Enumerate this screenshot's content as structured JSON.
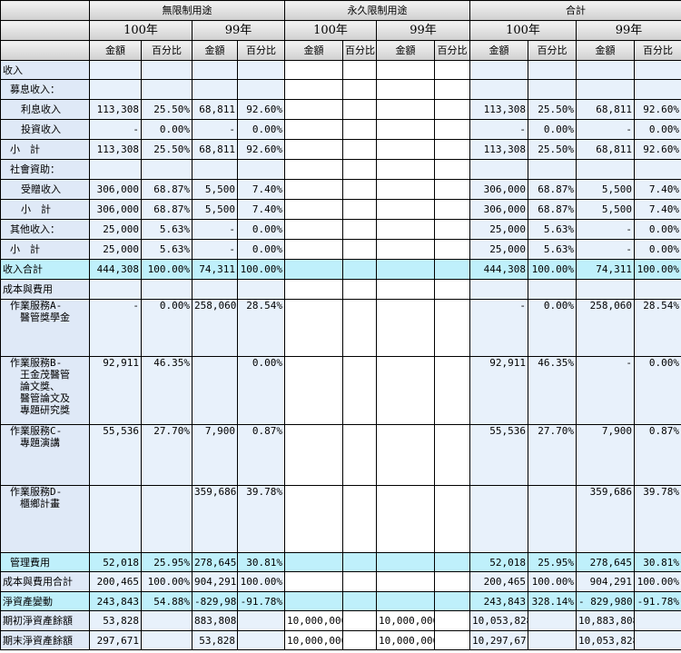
{
  "header": {
    "groups": [
      "無限制用途",
      "永久限制用途",
      "合計"
    ],
    "years": [
      "100年",
      "99年",
      "100年",
      "99年",
      "100年",
      "99年"
    ],
    "amount_label": "金額",
    "percent_label": "百分比"
  },
  "rows": [
    {
      "label": "收入",
      "indent": 0,
      "style": "plain",
      "h": 21,
      "cells": [
        "",
        "",
        "",
        "",
        "",
        "",
        "",
        "",
        "",
        "",
        "",
        ""
      ]
    },
    {
      "label": "募息收入：",
      "indent": 1,
      "style": "plain",
      "h": 22,
      "cells": [
        "",
        "",
        "",
        "",
        "",
        "",
        "",
        "",
        "",
        "",
        "",
        ""
      ]
    },
    {
      "label": "利息收入",
      "indent": 2,
      "style": "plain",
      "h": 22,
      "cells": [
        "113,308",
        "25.50%",
        "68,811",
        "92.60%",
        "",
        "",
        "",
        "",
        "113,308",
        "25.50%",
        "68,811",
        "92.60%"
      ]
    },
    {
      "label": "投資收入",
      "indent": 2,
      "style": "plain",
      "h": 22,
      "cells": [
        "-",
        "0.00%",
        "-",
        "0.00%",
        "",
        "",
        "",
        "",
        "-",
        "0.00%",
        "-",
        "0.00%"
      ]
    },
    {
      "label": "小　計",
      "indent": 1,
      "style": "plain",
      "h": 22,
      "cells": [
        "113,308",
        "25.50%",
        "68,811",
        "92.60%",
        "",
        "",
        "",
        "",
        "113,308",
        "25.50%",
        "68,811",
        "92.60%"
      ]
    },
    {
      "label": "社會資助：",
      "indent": 1,
      "style": "plain",
      "h": 22,
      "cells": [
        "",
        "",
        "",
        "",
        "",
        "",
        "",
        "",
        "",
        "",
        "",
        ""
      ]
    },
    {
      "label": "受贈收入",
      "indent": 2,
      "style": "plain",
      "h": 22,
      "cells": [
        "306,000",
        "68.87%",
        "5,500",
        "7.40%",
        "",
        "",
        "",
        "",
        "306,000",
        "68.87%",
        "5,500",
        "7.40%"
      ]
    },
    {
      "label": "小　計",
      "indent": 2,
      "style": "plain",
      "h": 22,
      "cells": [
        "306,000",
        "68.87%",
        "5,500",
        "7.40%",
        "",
        "",
        "",
        "",
        "306,000",
        "68.87%",
        "5,500",
        "7.40%"
      ]
    },
    {
      "label": "其他收入：",
      "indent": 1,
      "style": "plain",
      "h": 22,
      "cells": [
        "25,000",
        "5.63%",
        "-",
        "0.00%",
        "",
        "",
        "",
        "",
        "25,000",
        "5.63%",
        "-",
        "0.00%"
      ]
    },
    {
      "label": "小　計",
      "indent": 1,
      "style": "plain",
      "h": 22,
      "cells": [
        "25,000",
        "5.63%",
        "-",
        "0.00%",
        "",
        "",
        "",
        "",
        "25,000",
        "5.63%",
        "-",
        "0.00%"
      ]
    },
    {
      "label": "收入合計",
      "indent": 0,
      "style": "total",
      "h": 22,
      "cells": [
        "444,308",
        "100.00%",
        "74,311",
        "100.00%",
        "",
        "",
        "",
        "",
        "444,308",
        "100.00%",
        "74,311",
        "100.00%"
      ]
    },
    {
      "label": "成本與費用",
      "indent": 0,
      "style": "plain",
      "h": 22,
      "cells": [
        "",
        "",
        "",
        "",
        "",
        "",
        "",
        "",
        "",
        "",
        "",
        ""
      ]
    },
    {
      "label": "作業服務A-\n　醫管獎學金",
      "indent": 1,
      "style": "plain",
      "h": 63,
      "top": true,
      "cells": [
        "-",
        "0.00%",
        "258,060",
        "28.54%",
        "",
        "",
        "",
        "",
        "-",
        "0.00%",
        "258,060",
        "28.54%"
      ]
    },
    {
      "label": "作業服務B-\n　王金茂醫管\n　論文獎、\n　醫管論文及\n　專題研究獎",
      "indent": 1,
      "style": "plain",
      "h": 75,
      "top": true,
      "cells": [
        "92,911",
        "46.35%",
        "",
        "0.00%",
        "",
        "",
        "",
        "",
        "92,911",
        "46.35%",
        "-",
        "0.00%"
      ]
    },
    {
      "label": "作業服務C-\n　專題演講",
      "indent": 1,
      "style": "plain",
      "h": 67,
      "top": true,
      "cells": [
        "55,536",
        "27.70%",
        "7,900",
        "0.87%",
        "",
        "",
        "",
        "",
        "55,536",
        "27.70%",
        "7,900",
        "0.87%"
      ]
    },
    {
      "label": "作業服務D-\n　櫃鄉計畫",
      "indent": 1,
      "style": "plain",
      "h": 74,
      "top": true,
      "cells": [
        "",
        "",
        "359,686",
        "39.78%",
        "",
        "",
        "",
        "",
        "",
        "",
        "359,686",
        "39.78%"
      ]
    },
    {
      "label": "管理費用",
      "indent": 1,
      "style": "total",
      "h": 21,
      "cells": [
        "52,018",
        "25.95%",
        "278,645",
        "30.81%",
        "",
        "",
        "",
        "",
        "52,018",
        "25.95%",
        "278,645",
        "30.81%"
      ]
    },
    {
      "label": "成本與費用合計",
      "indent": 0,
      "style": "plain",
      "h": 22,
      "cells": [
        "200,465",
        "100.00%",
        "904,291",
        "100.00%",
        "",
        "",
        "",
        "",
        "200,465",
        "100.00%",
        "904,291",
        "100.00%"
      ]
    },
    {
      "label": "淨資產變動",
      "indent": 0,
      "style": "total",
      "h": 21,
      "cells": [
        "243,843",
        "54.88%",
        "-829,980",
        "-91.78%",
        "",
        "",
        "",
        "",
        "243,843",
        "328.14%",
        "- 829,980",
        "-91.78%"
      ]
    },
    {
      "label": "期初淨資產餘額",
      "indent": 0,
      "style": "plain",
      "h": 22,
      "cells": [
        "53,828",
        "",
        "883,808",
        "",
        "10,000,000",
        "",
        "10,000,000",
        "",
        "10,053,828",
        "",
        "10,883,808",
        ""
      ]
    },
    {
      "label": "期末淨資產餘額",
      "indent": 0,
      "style": "plain",
      "h": 21,
      "cells": [
        "297,671",
        "",
        "53,828",
        "",
        "10,000,000",
        "",
        "10,000,000",
        "",
        "10,297,671",
        "",
        "10,053,828",
        ""
      ]
    }
  ]
}
